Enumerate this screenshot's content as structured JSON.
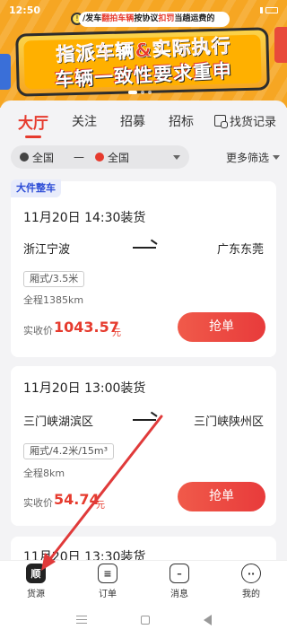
{
  "status_bar": {
    "time": "12:50"
  },
  "banner": {
    "ticker_prefix": "/发车",
    "ticker_highlight1": "翻拍车辆",
    "ticker_mid": "按协议",
    "ticker_highlight2": "扣罚",
    "ticker_suffix": "当趟运费的",
    "line1": "指派车辆&实际执行",
    "line2": "车辆一致性要求重申"
  },
  "tabs": [
    {
      "label": "大厅"
    },
    {
      "label": "关注"
    },
    {
      "label": "招募"
    },
    {
      "label": "招标"
    }
  ],
  "history": {
    "label": "找货记录"
  },
  "filter": {
    "from": "全国",
    "dash": "—",
    "to": "全国",
    "more": "更多筛选"
  },
  "cards": [
    {
      "tag": "大件整车",
      "date": "11月20日 14:30装货",
      "from": "浙江宁波",
      "to": "广东东莞",
      "spec": "厢式/3.5米",
      "distance": "全程1385km",
      "price_label": "实收价",
      "price": "1043.57",
      "unit": "元",
      "button": "抢单"
    },
    {
      "tag": "",
      "date": "11月20日 13:00装货",
      "from": "三门峡湖滨区",
      "to": "三门峡陕州区",
      "spec": "厢式/4.2米/15m³",
      "distance": "全程8km",
      "price_label": "实收价",
      "price": "54.74",
      "unit": "元",
      "button": "抢单"
    },
    {
      "date": "11月20日 13:30装货"
    }
  ],
  "bottom_nav": [
    {
      "label": "货源",
      "icon_text": "顺"
    },
    {
      "label": "订单"
    },
    {
      "label": "消息"
    },
    {
      "label": "我的"
    }
  ],
  "colors": {
    "accent": "#e63b2e",
    "banner": "#f6a623"
  }
}
